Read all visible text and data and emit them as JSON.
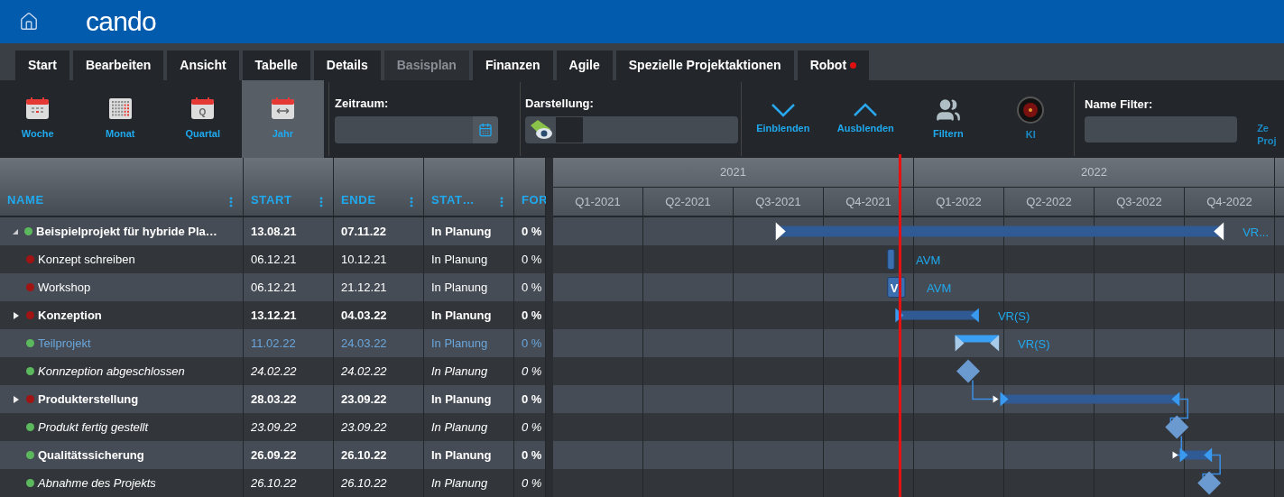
{
  "header": {
    "logo": "cando"
  },
  "tabs": [
    {
      "label": "Start",
      "disabled": false,
      "notification": false
    },
    {
      "label": "Bearbeiten",
      "disabled": false,
      "notification": false
    },
    {
      "label": "Ansicht",
      "disabled": false,
      "notification": false
    },
    {
      "label": "Tabelle",
      "disabled": false,
      "notification": false
    },
    {
      "label": "Details",
      "disabled": false,
      "notification": false
    },
    {
      "label": "Basisplan",
      "disabled": true,
      "notification": false
    },
    {
      "label": "Finanzen",
      "disabled": false,
      "notification": false
    },
    {
      "label": "Agile",
      "disabled": false,
      "notification": false
    },
    {
      "label": "Spezielle Projektaktionen",
      "disabled": false,
      "notification": false
    },
    {
      "label": "Robot",
      "disabled": false,
      "notification": true
    }
  ],
  "toolbar": {
    "views": [
      {
        "label": "Woche",
        "kind": "week",
        "selected": false
      },
      {
        "label": "Monat",
        "kind": "month",
        "selected": false
      },
      {
        "label": "Quartal",
        "kind": "quarter",
        "icon_text": "Q",
        "selected": false
      },
      {
        "label": "Jahr",
        "kind": "year",
        "selected": true
      }
    ],
    "zeitraum": {
      "label": "Zeitraum:"
    },
    "darstellung": {
      "label": "Darstellung:"
    },
    "actions": [
      {
        "label": "Einblenden",
        "kind": "expand"
      },
      {
        "label": "Ausblenden",
        "kind": "collapse"
      },
      {
        "label": "Filtern",
        "kind": "filter"
      },
      {
        "label": "KI",
        "kind": "ai"
      }
    ],
    "name_filter": {
      "label": "Name Filter:"
    },
    "cut_button": {
      "label": "Ze Proj"
    }
  },
  "table": {
    "columns": [
      "NAME",
      "START",
      "ENDE",
      "STAT…",
      "FOR"
    ],
    "rows": [
      {
        "kind": "project",
        "name": "Beispielprojekt für hybride Pla…",
        "start": "13.08.21",
        "end": "07.11.22",
        "status": "In Planung",
        "progress": "0 %",
        "color": "#5cb85c",
        "expanded": true,
        "bar_label": "VR..."
      },
      {
        "kind": "task",
        "name": "Konzept schreiben",
        "start": "06.12.21",
        "end": "10.12.21",
        "status": "In Planung",
        "progress": "0 %",
        "color": "#a01414",
        "bar_label": "AVM"
      },
      {
        "kind": "task",
        "name": "Workshop",
        "start": "06.12.21",
        "end": "21.12.21",
        "status": "In Planung",
        "progress": "0 %",
        "color": "#a01414",
        "bar_label": "AVM",
        "bar_text": "V"
      },
      {
        "kind": "summary",
        "name": "Konzeption",
        "start": "13.12.21",
        "end": "04.03.22",
        "status": "In Planung",
        "progress": "0 %",
        "color": "#a01414",
        "expanded": false,
        "bar_label": "VR(S)"
      },
      {
        "kind": "subproject",
        "name": "Teilprojekt",
        "start": "11.02.22",
        "end": "24.03.22",
        "status": "In Planung",
        "progress": "0 %",
        "color": "#5cb85c",
        "bar_label": "VR(S)"
      },
      {
        "kind": "milestone",
        "name": "Konnzeption abgeschlossen",
        "start": "24.02.22",
        "end": "24.02.22",
        "status": "In Planung",
        "progress": "0 %",
        "color": "#5cb85c"
      },
      {
        "kind": "summary",
        "name": "Produkterstellung",
        "start": "28.03.22",
        "end": "23.09.22",
        "status": "In Planung",
        "progress": "0 %",
        "color": "#a01414",
        "expanded": false,
        "linked": true
      },
      {
        "kind": "milestone",
        "name": "Produkt fertig gestellt",
        "start": "23.09.22",
        "end": "23.09.22",
        "status": "In Planung",
        "progress": "0 %",
        "color": "#5cb85c",
        "linked": true
      },
      {
        "kind": "summary",
        "name": "Qualitätssicherung",
        "start": "26.09.22",
        "end": "26.10.22",
        "status": "In Planung",
        "progress": "0 %",
        "color": "#5cb85c",
        "linked": true
      },
      {
        "kind": "milestone",
        "name": "Abnahme des Projekts",
        "start": "26.10.22",
        "end": "26.10.22",
        "status": "In Planung",
        "progress": "0 %",
        "color": "#5cb85c",
        "linked": true
      }
    ]
  },
  "gantt": {
    "years": [
      "2021",
      "2022"
    ],
    "quarters": [
      "Q1-2021",
      "Q2-2021",
      "Q3-2021",
      "Q4-2021",
      "Q1-2022",
      "Q2-2022",
      "Q3-2022",
      "Q4-2022"
    ],
    "today_marker": {
      "level": 0.474
    }
  }
}
